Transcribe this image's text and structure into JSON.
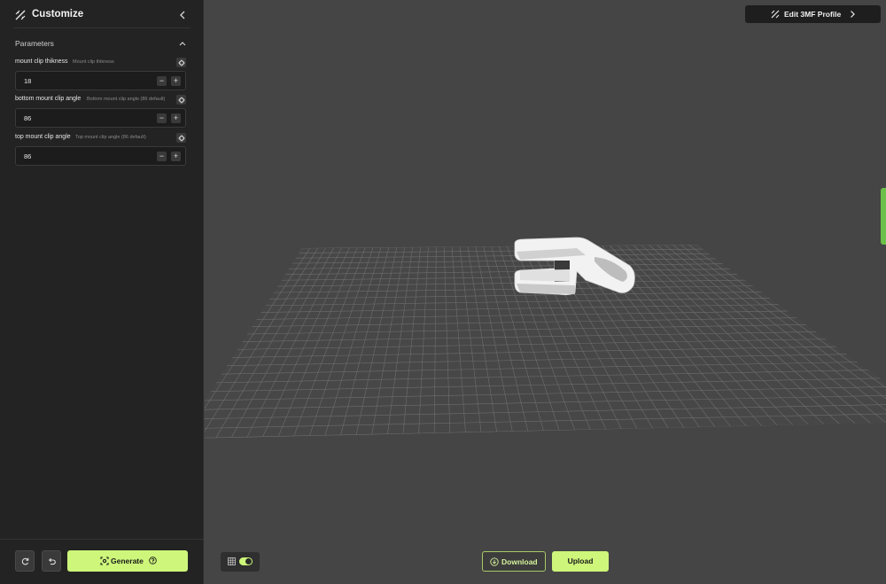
{
  "sidebar": {
    "title": "Customize",
    "logo_icon": "pencil-ruler-icon",
    "collapse_icon": "chevron-left-icon",
    "section": {
      "label": "Parameters",
      "toggle_icon": "chevron-up-icon"
    },
    "parameters": [
      {
        "name": "mount clip thikness",
        "description": "Mount clip thikness",
        "value": "18"
      },
      {
        "name": "bottom mount clip angle",
        "description": "Bottom mount clip angle (86 default)",
        "value": "86"
      },
      {
        "name": "top mount clip angle",
        "description": "Top mount clip angle (86 default)",
        "value": "86"
      }
    ],
    "stepper": {
      "minus": "−",
      "plus": "+"
    },
    "footer": {
      "reset_icon": "refresh-icon",
      "undo_icon": "undo-icon",
      "generate_label": "Generate",
      "generate_icon": "generate-icon",
      "help_icon": "help-icon"
    }
  },
  "viewport": {
    "edit_profile_label": "Edit 3MF Profile",
    "grid_toggle": {
      "icon": "grid-icon",
      "enabled": true
    },
    "download_label": "Download",
    "download_icon": "download-icon",
    "upload_label": "Upload"
  },
  "colors": {
    "accent": "#cdf67a",
    "sidebar_bg": "#232323",
    "viewport_bg": "#454545",
    "side_tab": "#6cc04a"
  }
}
